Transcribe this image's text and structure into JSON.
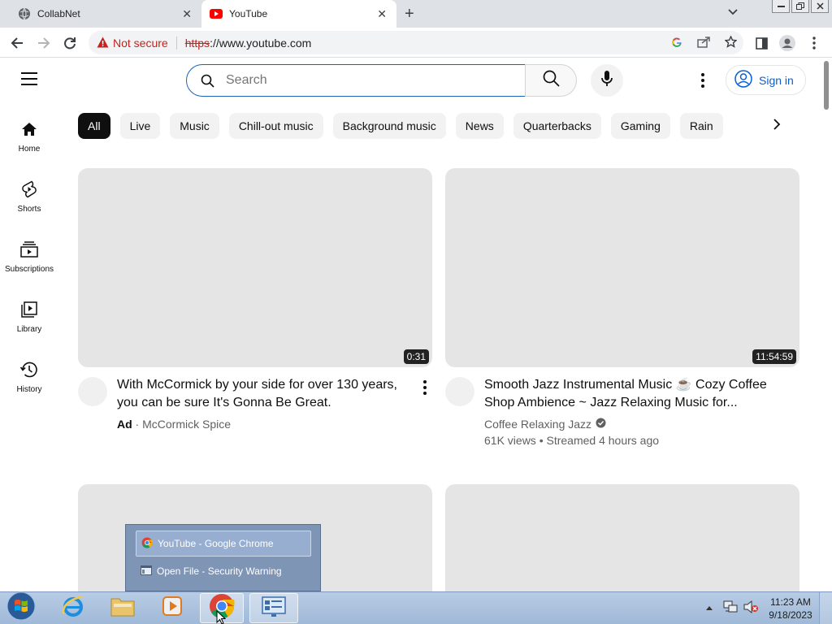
{
  "browser": {
    "tabs": [
      {
        "title": "CollabNet",
        "icon": "globe-icon"
      },
      {
        "title": "YouTube",
        "icon": "youtube-icon"
      }
    ],
    "new_tab": "+",
    "address": {
      "security_label": "Not secure",
      "url_scheme": "https",
      "url_rest": "://www.youtube.com"
    }
  },
  "youtube": {
    "search_placeholder": "Search",
    "sign_in": "Sign in",
    "nav": [
      {
        "label": "Home",
        "icon": "home-icon"
      },
      {
        "label": "Shorts",
        "icon": "shorts-icon"
      },
      {
        "label": "Subscriptions",
        "icon": "subscriptions-icon"
      },
      {
        "label": "Library",
        "icon": "library-icon"
      },
      {
        "label": "History",
        "icon": "history-icon"
      }
    ],
    "chips": [
      "All",
      "Live",
      "Music",
      "Chill-out music",
      "Background music",
      "News",
      "Quarterbacks",
      "Gaming",
      "Rain"
    ],
    "videos": [
      {
        "title_line1": "With McCormick by your side for over 130 years,",
        "title_line2": "you can be sure It's Gonna Be Great.",
        "ad_label": "Ad",
        "channel": "McCormick Spice",
        "duration": "0:31"
      },
      {
        "title_line1": "Smooth Jazz Instrumental Music ☕ Cozy Coffee",
        "title_line2": "Shop Ambience ~ Jazz Relaxing Music for...",
        "channel": "Coffee Relaxing Jazz",
        "meta": "61K views • Streamed 4 hours ago",
        "duration": "11:54:59"
      }
    ]
  },
  "taskbar": {
    "popup_items": [
      "YouTube - Google Chrome",
      "Open File - Security Warning"
    ],
    "time": "11:23 AM",
    "date": "9/18/2023"
  },
  "colors": {
    "accent": "#065fd4",
    "warning": "#c5221f",
    "chip_active": "#0f0f0f"
  }
}
